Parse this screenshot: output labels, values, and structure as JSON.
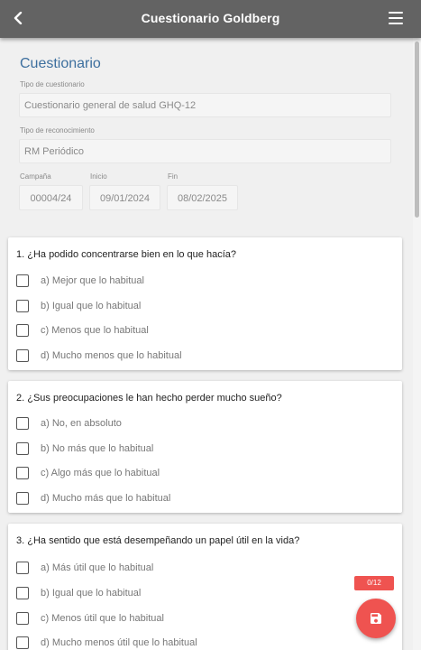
{
  "appbar": {
    "title": "Cuestionario Goldberg"
  },
  "form": {
    "section_title": "Cuestionario",
    "tipo_cuestionario_label": "Tipo de cuestionario",
    "tipo_cuestionario_value": "Cuestionario general de salud GHQ-12",
    "tipo_reconocimiento_label": "Tipo de reconocimiento",
    "tipo_reconocimiento_value": "RM Periódico",
    "campana_label": "Campaña",
    "campana_value": "00004/24",
    "inicio_label": "Inicio",
    "inicio_value": "09/01/2024",
    "fin_label": "Fin",
    "fin_value": "08/02/2025"
  },
  "questions": [
    {
      "text": "1. ¿Ha podido concentrarse bien en lo que hacía?",
      "options": [
        "a) Mejor que lo habitual",
        "b) Igual que lo habitual",
        "c) Menos que lo habitual",
        "d) Mucho menos que lo habitual"
      ]
    },
    {
      "text": "2. ¿Sus preocupaciones le han hecho perder mucho sueño?",
      "options": [
        "a) No, en absoluto",
        "b) No más que lo habitual",
        "c) Algo más que lo habitual",
        "d) Mucho más que lo habitual"
      ]
    },
    {
      "text": "3. ¿Ha sentido que está desempeñando un papel útil en la vida?",
      "options": [
        "a) Más útil que lo habitual",
        "b) Igual que lo habitual",
        "c) Menos útil que lo habitual",
        "d) Mucho menos útil que lo habitual"
      ]
    }
  ],
  "progress": {
    "counter": "0/12",
    "answered": 0,
    "total": 12
  },
  "colors": {
    "appbar": "#636363",
    "accent": "#ef5350",
    "section_title": "#3d6f9e"
  },
  "icons": {
    "back": "chevron-left-icon",
    "menu": "hamburger-menu-icon",
    "save": "floppy-disk-icon"
  }
}
